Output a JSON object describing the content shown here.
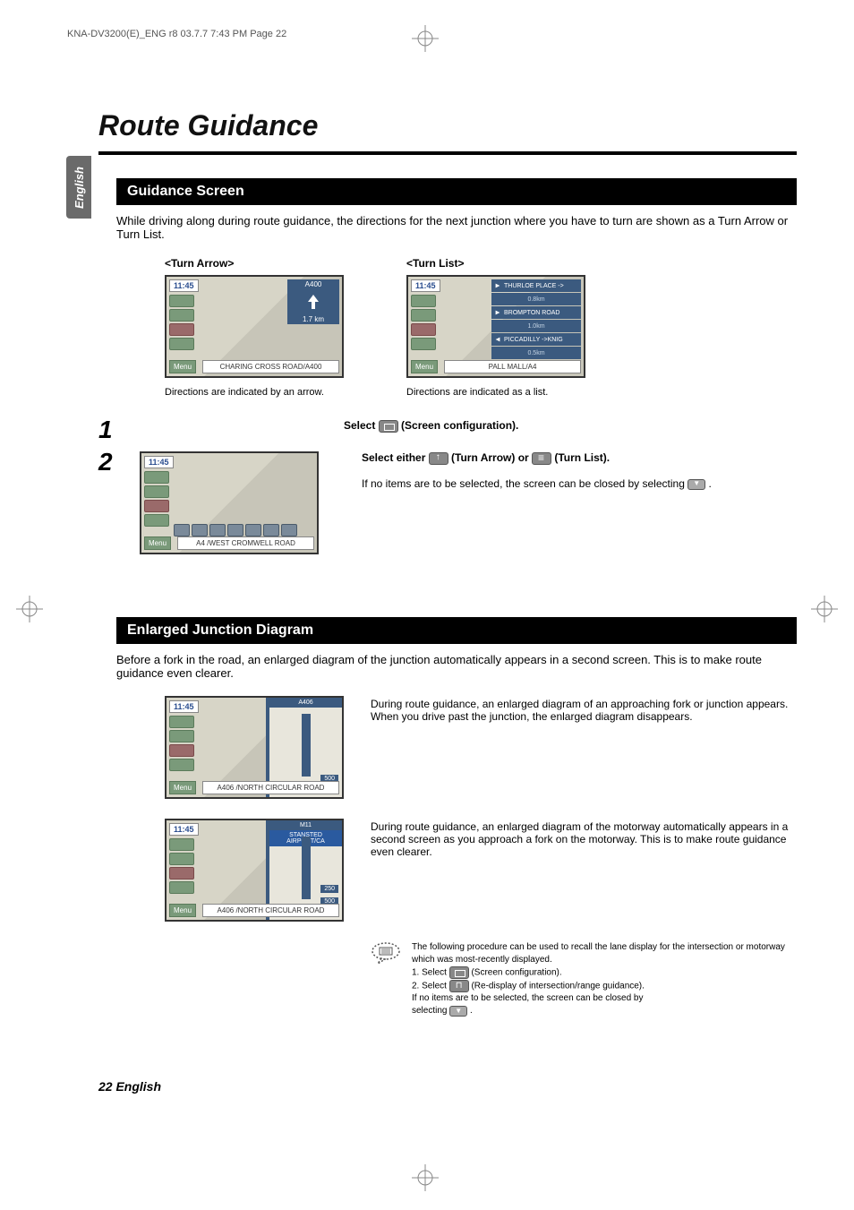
{
  "header": {
    "doc_ref": "KNA-DV3200(E)_ENG r8  03.7.7  7:43 PM  Page 22"
  },
  "sidebar": {
    "language": "English"
  },
  "page": {
    "title": "Route Guidance",
    "footer": "22 English"
  },
  "section1": {
    "heading": "Guidance Screen",
    "intro": "While driving along during route guidance, the directions for the next junction where you have to turn are shown as a Turn Arrow or Turn List.",
    "col1": {
      "label": "<Turn Arrow>",
      "screenshot": {
        "time": "11:45",
        "arrow_road": "A400",
        "arrow_dist": "1.7",
        "arrow_unit": "km",
        "bottom_road": "CHARING CROSS ROAD/A400",
        "menu": "Menu"
      },
      "caption": "Directions are indicated by an arrow."
    },
    "col2": {
      "label": "<Turn List>",
      "screenshot": {
        "time": "11:45",
        "list": [
          {
            "name": "THURLOE PLACE ->",
            "arrow": "right"
          },
          {
            "dist": "0.8km"
          },
          {
            "name": "BROMPTON ROAD",
            "arrow": "right"
          },
          {
            "dist": "1.0km"
          },
          {
            "name": "PICCADILLY ->KNIG",
            "arrow": "left"
          },
          {
            "dist": "0.5km"
          }
        ],
        "bottom_road": "PALL MALL/A4",
        "menu": "Menu"
      },
      "caption": "Directions are indicated as a list."
    },
    "step1": {
      "num": "1",
      "text_a": "Select ",
      "text_b": " (Screen configuration)."
    },
    "step2": {
      "num": "2",
      "text_a": "Select either ",
      "text_b": " (Turn Arrow) or ",
      "text_c": " (Turn List).",
      "note_a": "If no items are to be selected, the screen can be closed by selecting ",
      "note_b": " .",
      "screenshot": {
        "time": "11:45",
        "bottom_road": "A4 /WEST CROMWELL ROAD",
        "menu": "Menu"
      }
    }
  },
  "section2": {
    "heading": "Enlarged Junction Diagram",
    "intro": "Before a fork in the road, an enlarged diagram of the junction automatically appears in a second screen. This is to make route guidance even clearer.",
    "row1": {
      "screenshot": {
        "time": "11:45",
        "split_header": "A406",
        "split_dist": "500",
        "bottom_road": "A406 /NORTH CIRCULAR ROAD",
        "menu": "Menu"
      },
      "text": "During route guidance, an enlarged diagram of an approaching fork or junction appears. When you drive past the junction, the enlarged diagram disappears."
    },
    "row2": {
      "screenshot": {
        "time": "11:45",
        "split_header_a": "M11",
        "split_header_b": "STANSTED AIRPORT/CA",
        "split_dist_a": "500",
        "split_dist_b": "250",
        "bottom_road": "A406 /NORTH CIRCULAR ROAD",
        "menu": "Menu"
      },
      "text": "During route guidance, an enlarged diagram of the motorway automatically appears in a second screen as you approach a fork on the motorway. This is to make route guidance even clearer."
    },
    "note": {
      "line1": "The following procedure can be used to recall the lane display for the intersection or motorway which was most-recently displayed.",
      "line2a": "1. Select ",
      "line2b": " (Screen configuration).",
      "line3a": "2. Select ",
      "line3b": " (Re-display of intersection/range guidance).",
      "line4a": "   If no items are to be selected, the screen can be closed by",
      "line4b": "   selecting ",
      "line4c": " ."
    }
  }
}
